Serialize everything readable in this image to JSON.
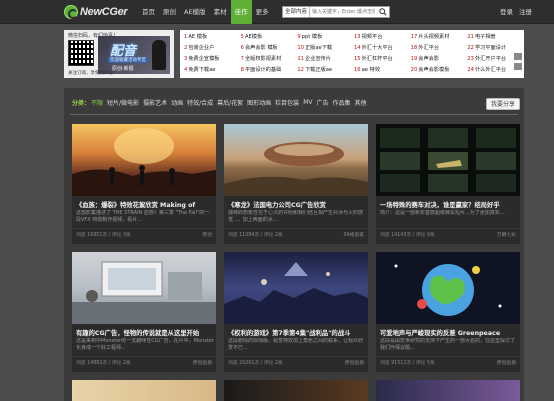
{
  "nav": {
    "logo": "NewCGer",
    "items": [
      "首页",
      "原创",
      "AE模版",
      "素材",
      "佳作",
      "更多"
    ],
    "active_index": 4,
    "search_select": "全部内容",
    "search_placeholder": "输入关键字，Enter 或点击搜索",
    "login": "登录",
    "register": "注册"
  },
  "promo": {
    "top_text": "微信扫码，有们惊喜！",
    "title": "配音",
    "subtitle": "欢迎收藏活动专区",
    "tag": "原创·新报",
    "bottom_text": "关注订阅，享免费体验！"
  },
  "links": [
    {
      "num": "1",
      "text": "AE 模板"
    },
    {
      "num": "5",
      "text": "AE模板"
    },
    {
      "num": "9",
      "text": "ppt 模板"
    },
    {
      "num": "13",
      "text": "视频平台"
    },
    {
      "num": "17",
      "text": "片头视频素材"
    },
    {
      "num": "21",
      "text": "电子相册"
    },
    {
      "num": "2",
      "text": "包装企业户"
    },
    {
      "num": "6",
      "text": "会声会影 模板"
    },
    {
      "num": "10",
      "text": "正版ae下载"
    },
    {
      "num": "14",
      "text": "外汇十大平台"
    },
    {
      "num": "18",
      "text": "外汇平台"
    },
    {
      "num": "22",
      "text": "学习平面设计"
    },
    {
      "num": "3",
      "text": "免费企宣模板"
    },
    {
      "num": "7",
      "text": "全版权影视素材"
    },
    {
      "num": "11",
      "text": "企业宣传片"
    },
    {
      "num": "15",
      "text": "外汇杠杆平台"
    },
    {
      "num": "19",
      "text": "会声会影"
    },
    {
      "num": "23",
      "text": "外汇开户平台"
    },
    {
      "num": "4",
      "text": "免费下载ae"
    },
    {
      "num": "8",
      "text": "平面设计的基础"
    },
    {
      "num": "12",
      "text": "下载正版ae"
    },
    {
      "num": "16",
      "text": "ae 特效"
    },
    {
      "num": "20",
      "text": "会声会影模板"
    },
    {
      "num": "24",
      "text": "什么外汇平台"
    }
  ],
  "categories": {
    "label": "分类：",
    "items": [
      "不限",
      "短片/微电影",
      "摄影艺术",
      "动画",
      "特效/合成",
      "幕后/花絮",
      "图形动画",
      "栏目包装",
      "MV",
      "广告",
      "作品集",
      "其他"
    ],
    "active_index": 0
  },
  "share_label": "我要分享",
  "cards": [
    {
      "title": "《血族：爆裂》特效花絮欣赏 Making of",
      "desc": "这部影集描述了 THE STRAIN 血族》第三季 \"The Fall\"的一段VFX 特效制作视频，看片...",
      "meta": "浏览 16951次 / 评论 3条",
      "author": "原创"
    },
    {
      "title": "《寒龙》法国电力公司CG广告欣赏",
      "desc": "独特的想象性在于心灵的许纷和我们结互相产生对冰与火的感觉...，加上两面的冰...",
      "meta": "浏览 11084次 / 评论 2条",
      "author": "99格窗家"
    },
    {
      "title": "一场特殊的赛车对决，谁是赢家？结局好乎",
      "desc": "简介：这是一部新年首款超级赛车短片...为了更加真实...",
      "meta": "浏览 14143次 / 评论 9条",
      "author": "万朝七彩"
    },
    {
      "title": "有趣的CG广告，怪物的传说就是从这里开始",
      "desc": "这是来到中Monster的一支趣味性CG广告，在片中，Monster化身成一个好工程师...",
      "meta": "浏览 14882次 / 评论 2条",
      "author": "原创画报"
    },
    {
      "title": "《权利的游戏》第7季第4集\"战利品\"的战斗",
      "desc": "这段剧情的现场版，视觉特效加上角色之间的联系，让观众欣赏不已...",
      "meta": "浏览 20291次 / 评论 2条",
      "author": "原创画报"
    },
    {
      "title": "可爱地声与严峻现实的反差 Greenpeace",
      "desc": "这段是由宏世研究的支持下产生的一部大名的，在这里探讨了我们环保议题...",
      "meta": "浏览 91512次 / 评论 5条",
      "author": "原创画报"
    }
  ]
}
